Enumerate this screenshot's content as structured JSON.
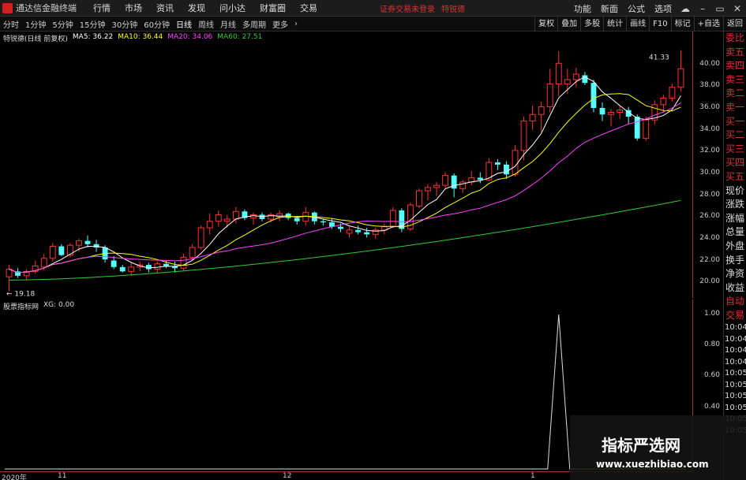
{
  "app": {
    "title": "通达信金融终端"
  },
  "menu": {
    "items": [
      "行情",
      "市场",
      "资讯",
      "发现",
      "问小达",
      "财富圈",
      "交易"
    ],
    "login_status": "证券交易未登录",
    "login_user": "特锐德",
    "right": [
      "功能",
      "新面",
      "公式",
      "选项"
    ]
  },
  "periods": {
    "items": [
      "分时",
      "1分钟",
      "5分钟",
      "15分钟",
      "30分钟",
      "60分钟",
      "日线",
      "周线",
      "月线",
      "多周期",
      "更多"
    ],
    "active": "日线"
  },
  "toolbar": {
    "right": [
      "复权",
      "叠加",
      "多股",
      "统计",
      "画线",
      "F10",
      "标记",
      "+自选",
      "返回"
    ]
  },
  "legend": {
    "stock": "特锐德(日线 前复权)",
    "ma5": "MA5: 36.22",
    "ma10": "MA10: 36.44",
    "ma20": "MA20: 34.06",
    "ma60": "MA60: 27.51"
  },
  "indicator": {
    "name": "股票指标网",
    "xg": "XG: 0.00"
  },
  "price_axis": [
    "40.00",
    "38.00",
    "36.00",
    "34.00",
    "32.00",
    "30.00",
    "28.00",
    "26.00",
    "24.00",
    "22.00",
    "20.00"
  ],
  "ind_axis": [
    "1.00",
    "0.80",
    "0.60",
    "0.40"
  ],
  "annotations": {
    "high": "41.33",
    "low": "19.18"
  },
  "dates": [
    "2020年",
    "11",
    "12",
    "1"
  ],
  "side": {
    "items": [
      "委比",
      "卖五",
      "卖四",
      "卖三",
      "卖二",
      "卖一",
      "买一",
      "买二",
      "买三",
      "买四",
      "买五",
      "现价",
      "涨跌",
      "涨幅",
      "总量",
      "外盘",
      "换手",
      "净资",
      "收益"
    ],
    "tabs": [
      "自动",
      "交易"
    ],
    "times": [
      "10:04",
      "10:04",
      "10:04",
      "10:04",
      "10:05",
      "10:05",
      "10:05",
      "10:05",
      "10:05",
      "10:05"
    ]
  },
  "watermark": {
    "title": "指标严选网",
    "url": "www.xuezhibiao.com"
  },
  "colors": {
    "up": "#ff3232",
    "down": "#54ffff",
    "ma5": "#ffffff",
    "ma10": "#ffff00",
    "ma20": "#ff44ff",
    "ma60": "#33cc33"
  },
  "chart_data": {
    "type": "candlestick",
    "ylim": [
      19,
      42
    ],
    "candles": [
      [
        20.5,
        21.6,
        19.2,
        21.2
      ],
      [
        21.0,
        21.3,
        20.4,
        20.6
      ],
      [
        20.6,
        21.2,
        20.2,
        21.0
      ],
      [
        21.0,
        22.0,
        20.8,
        21.5
      ],
      [
        21.4,
        22.6,
        21.1,
        22.2
      ],
      [
        22.2,
        23.6,
        21.9,
        23.3
      ],
      [
        23.3,
        23.5,
        22.4,
        22.5
      ],
      [
        22.5,
        23.6,
        22.3,
        23.4
      ],
      [
        23.4,
        24.0,
        22.8,
        23.8
      ],
      [
        23.8,
        24.3,
        23.2,
        23.5
      ],
      [
        23.5,
        23.9,
        22.8,
        23.2
      ],
      [
        23.2,
        23.4,
        21.8,
        22.1
      ],
      [
        22.0,
        22.4,
        21.2,
        21.4
      ],
      [
        21.4,
        21.6,
        20.9,
        21.0
      ],
      [
        21.0,
        21.8,
        20.6,
        21.4
      ],
      [
        21.4,
        21.9,
        21.0,
        21.6
      ],
      [
        21.6,
        21.8,
        20.9,
        21.2
      ],
      [
        21.2,
        21.9,
        20.9,
        21.7
      ],
      [
        21.7,
        22.0,
        21.3,
        21.5
      ],
      [
        21.5,
        21.9,
        20.9,
        21.3
      ],
      [
        21.3,
        22.6,
        21.1,
        22.3
      ],
      [
        22.3,
        23.5,
        22.0,
        23.2
      ],
      [
        23.2,
        25.2,
        23.0,
        25.0
      ],
      [
        25.0,
        26.3,
        24.4,
        25.6
      ],
      [
        25.6,
        26.6,
        25.1,
        26.2
      ],
      [
        25.6,
        26.2,
        25.0,
        25.8
      ],
      [
        25.8,
        26.9,
        25.4,
        26.5
      ],
      [
        26.5,
        26.7,
        25.7,
        25.9
      ],
      [
        25.9,
        26.4,
        25.3,
        26.2
      ],
      [
        26.2,
        26.4,
        25.6,
        25.8
      ],
      [
        25.8,
        26.4,
        25.5,
        26.2
      ],
      [
        26.0,
        26.6,
        25.6,
        26.3
      ],
      [
        26.3,
        26.4,
        25.7,
        25.9
      ],
      [
        25.9,
        26.1,
        25.3,
        25.6
      ],
      [
        25.6,
        26.9,
        25.2,
        26.4
      ],
      [
        26.4,
        26.5,
        25.3,
        25.6
      ],
      [
        25.6,
        25.8,
        25.2,
        25.5
      ],
      [
        25.5,
        25.9,
        24.9,
        25.1
      ],
      [
        25.1,
        25.4,
        24.6,
        24.9
      ],
      [
        24.5,
        25.1,
        24.1,
        24.8
      ],
      [
        24.8,
        25.2,
        24.4,
        24.6
      ],
      [
        24.6,
        25.0,
        24.1,
        24.4
      ],
      [
        24.4,
        25.0,
        24.0,
        24.8
      ],
      [
        24.8,
        25.4,
        24.4,
        25.1
      ],
      [
        25.1,
        26.9,
        25.0,
        26.6
      ],
      [
        26.6,
        26.8,
        24.6,
        24.9
      ],
      [
        24.9,
        27.3,
        24.7,
        27.1
      ],
      [
        27.0,
        28.6,
        26.8,
        28.4
      ],
      [
        28.4,
        29.0,
        27.5,
        28.7
      ],
      [
        28.7,
        29.2,
        27.9,
        28.9
      ],
      [
        28.9,
        30.1,
        28.6,
        29.8
      ],
      [
        29.8,
        30.0,
        27.8,
        28.6
      ],
      [
        28.6,
        29.4,
        28.2,
        29.2
      ],
      [
        29.2,
        30.2,
        28.9,
        29.6
      ],
      [
        29.6,
        30.1,
        29.1,
        29.4
      ],
      [
        29.4,
        31.4,
        29.3,
        31.0
      ],
      [
        31.0,
        31.3,
        30.3,
        30.8
      ],
      [
        30.8,
        31.1,
        29.5,
        29.9
      ],
      [
        29.9,
        32.6,
        29.7,
        32.1
      ],
      [
        32.1,
        35.2,
        31.2,
        34.8
      ],
      [
        34.8,
        36.2,
        34.0,
        35.4
      ],
      [
        35.4,
        36.6,
        33.8,
        36.1
      ],
      [
        36.1,
        39.6,
        35.6,
        38.2
      ],
      [
        38.2,
        41.2,
        37.1,
        40.1
      ],
      [
        38.2,
        39.6,
        37.3,
        38.6
      ],
      [
        38.6,
        39.7,
        37.9,
        39.1
      ],
      [
        39.0,
        39.3,
        38.1,
        38.3
      ],
      [
        38.3,
        38.6,
        35.6,
        36.0
      ],
      [
        36.0,
        36.5,
        34.8,
        35.4
      ],
      [
        35.4,
        35.9,
        34.3,
        35.6
      ],
      [
        35.6,
        36.2,
        35.0,
        35.8
      ],
      [
        35.8,
        36.1,
        34.5,
        35.2
      ],
      [
        35.2,
        35.4,
        33.0,
        33.2
      ],
      [
        33.2,
        35.2,
        33.0,
        34.9
      ],
      [
        34.9,
        36.7,
        34.5,
        36.3
      ],
      [
        36.3,
        37.2,
        35.6,
        36.9
      ],
      [
        36.9,
        38.2,
        36.6,
        37.9
      ],
      [
        37.9,
        41.3,
        37.5,
        39.6
      ]
    ],
    "ma_start": [
      {
        "name": "MA5",
        "last": 36.22
      },
      {
        "name": "MA10",
        "last": 36.44
      },
      {
        "name": "MA20",
        "last": 34.06
      },
      {
        "name": "MA60",
        "last": 27.51
      }
    ],
    "xg_signal_index": 63
  }
}
